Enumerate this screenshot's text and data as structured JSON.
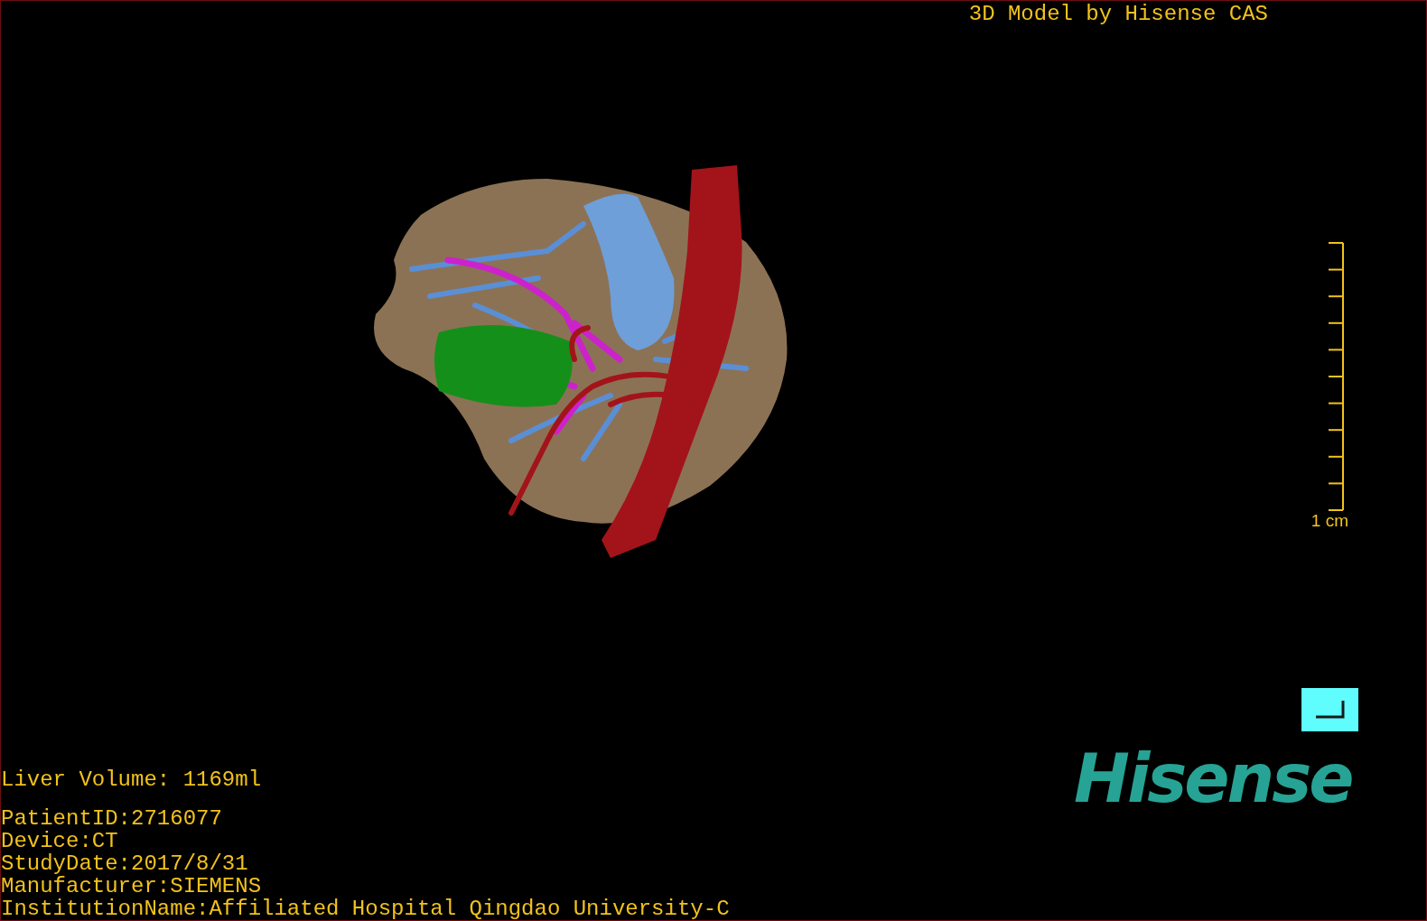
{
  "patient_info": [
    "PatientID:2716077",
    "Device:CT",
    "StudyDate:2017/8/31",
    "Manufacturer:SIEMENS",
    "InstitutionName:Affiliated Hospital Qingdao University-C"
  ],
  "model_title": "3D Model by Hisense CAS",
  "scale_bar": {
    "label": "1 cm"
  },
  "liver_volume": "Liver Volume: 1169ml",
  "logo": "Hisense"
}
